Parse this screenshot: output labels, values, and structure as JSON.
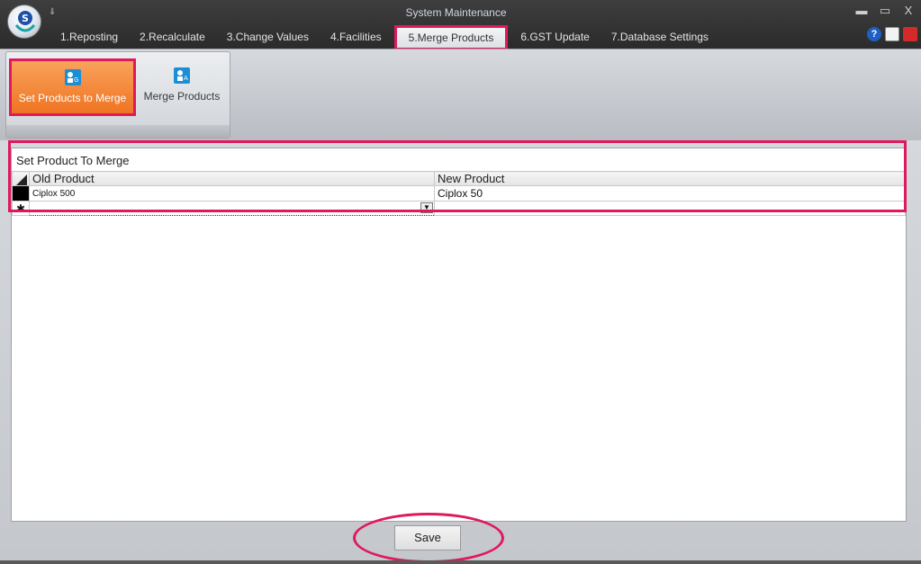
{
  "window": {
    "title": "System Maintenance",
    "minimize": "▬",
    "maximize": "▭",
    "close": "X",
    "qat_glyph": "⇓"
  },
  "tabs": [
    {
      "label": "1.Reposting"
    },
    {
      "label": "2.Recalculate"
    },
    {
      "label": "3.Change Values"
    },
    {
      "label": "4.Facilities"
    },
    {
      "label": "5.Merge Products",
      "active": true
    },
    {
      "label": "6.GST Update"
    },
    {
      "label": "7.Database Settings"
    }
  ],
  "ribbon": {
    "set_products_label": "Set Products to Merge",
    "merge_products_label": "Merge Products"
  },
  "grid": {
    "title": "Set Product To Merge",
    "columns": [
      "Old Product",
      "New Product"
    ],
    "rows": [
      {
        "old": "Ciplox 500",
        "new": "Ciplox  50"
      }
    ],
    "new_row_marker": "✱"
  },
  "actions": {
    "save_label": "Save"
  },
  "colors": {
    "accent_highlight": "#e0195d",
    "active_button": "#ef7422"
  }
}
